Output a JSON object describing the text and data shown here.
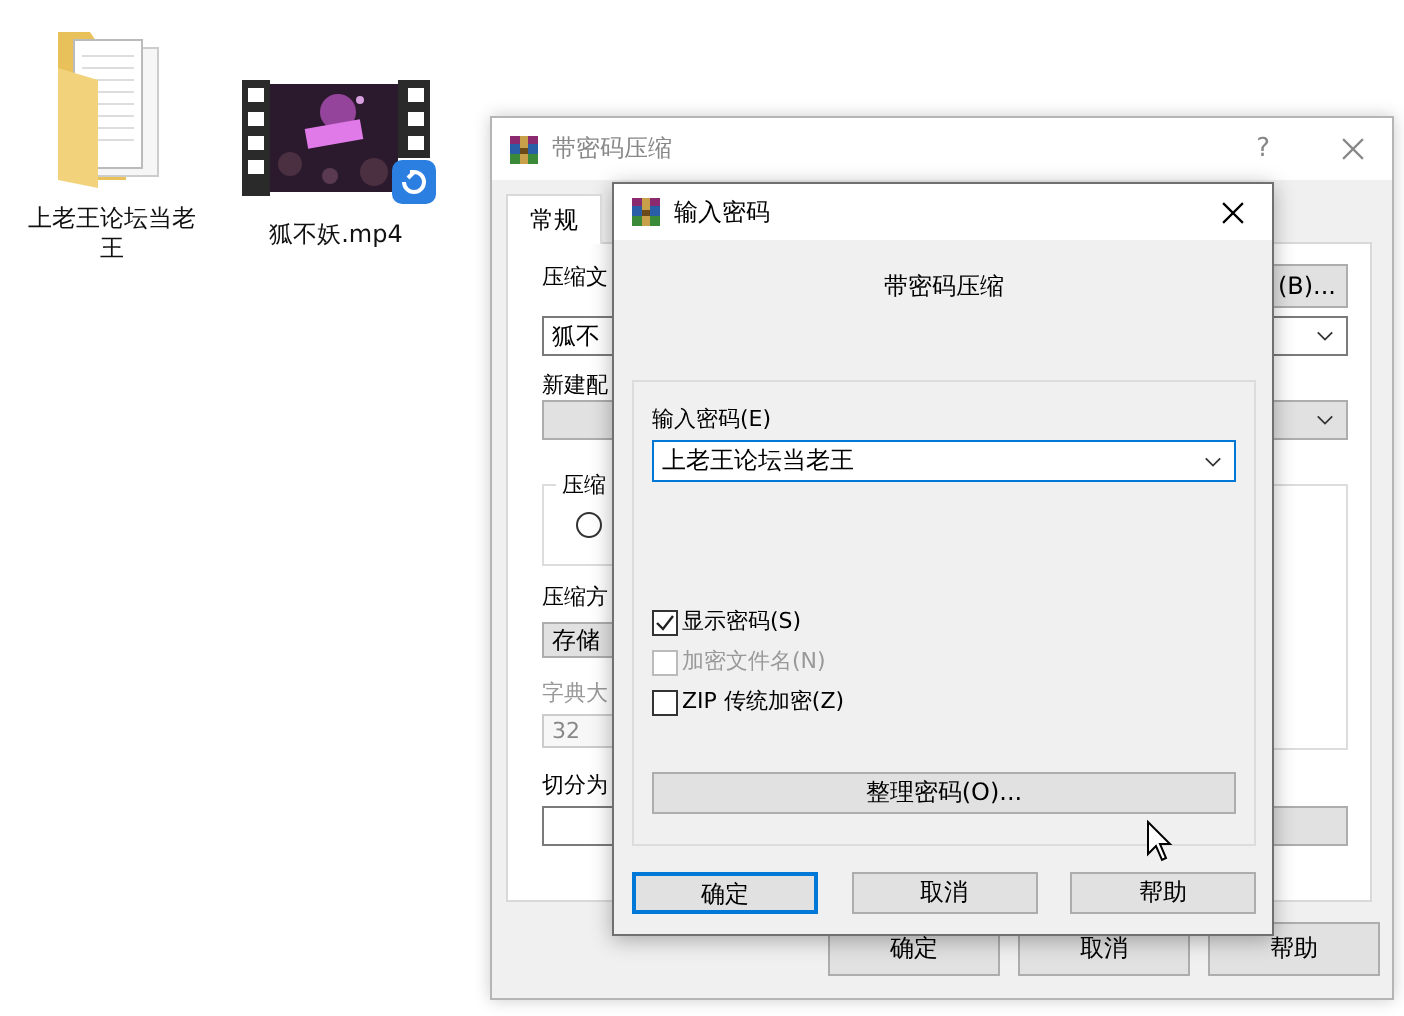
{
  "desktop_icons": [
    {
      "kind": "folder",
      "label": "上老王论坛当老王"
    },
    {
      "kind": "video",
      "label": "狐不妖.mp4"
    }
  ],
  "outer_dialog": {
    "title": "带密码压缩",
    "active": false,
    "help": "?",
    "tabs": [
      {
        "label": "常规",
        "selected": true
      }
    ],
    "archive_label": "压缩文",
    "browse_button": "(B)...",
    "archive_value": "狐不",
    "profile_label": "新建配",
    "format_group_label": "压缩",
    "format_option": {
      "selected": false
    },
    "method_label": "压缩方",
    "method_value": "存储",
    "dictionary_label": "字典大",
    "dictionary_value": "32",
    "dictionary_disabled": true,
    "split_label": "切分为",
    "buttons": [
      "确定",
      "取消",
      "帮助"
    ]
  },
  "password_dialog": {
    "title": "输入密码",
    "active": true,
    "heading": "带密码压缩",
    "password_label": "输入密码(E)",
    "password_value": "上老王论坛当老王",
    "options": [
      {
        "label": "显示密码(S)",
        "checked": true,
        "disabled": false
      },
      {
        "label": "加密文件名(N)",
        "checked": false,
        "disabled": true
      },
      {
        "label": "ZIP 传统加密(Z)",
        "checked": false,
        "disabled": false
      }
    ],
    "organize_button": "整理密码(O)...",
    "buttons": [
      {
        "label": "确定",
        "default": true
      },
      {
        "label": "取消",
        "default": false
      },
      {
        "label": "帮助",
        "default": false
      }
    ]
  }
}
